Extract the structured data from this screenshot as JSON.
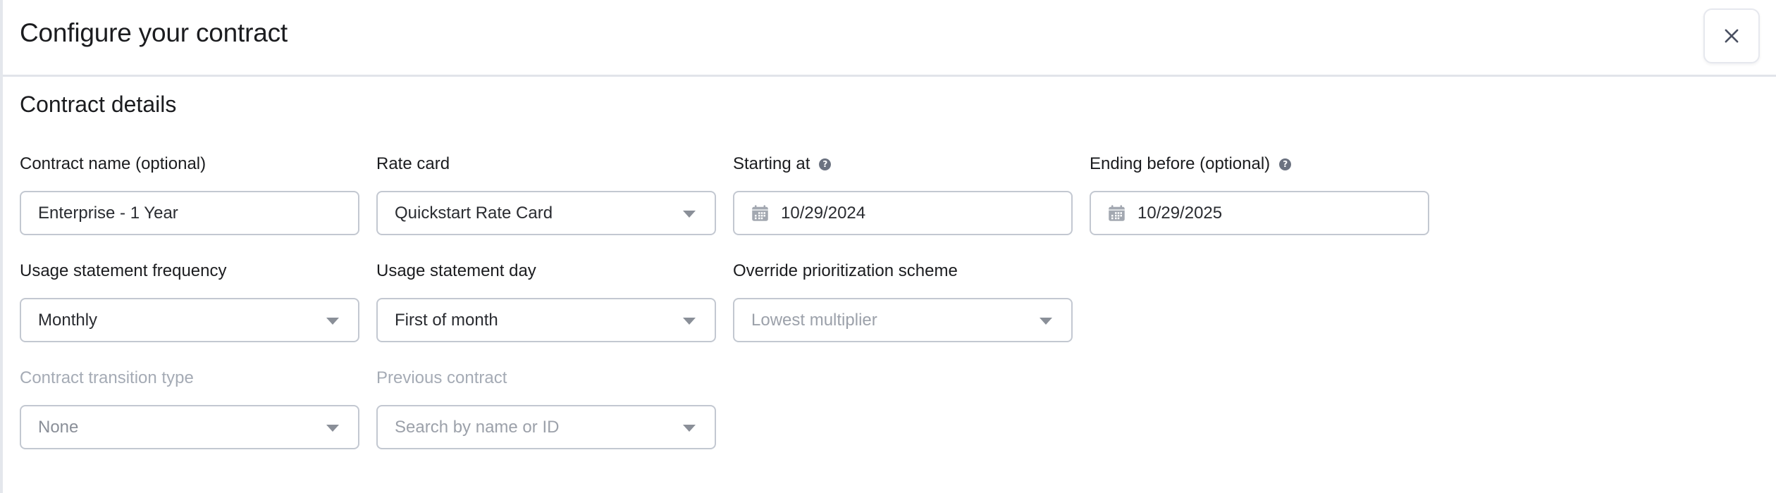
{
  "dialog": {
    "title": "Configure your contract",
    "close_icon": "close-icon"
  },
  "section": {
    "title": "Contract details"
  },
  "fields": {
    "contract_name": {
      "label": "Contract name (optional)",
      "value": "Enterprise - 1 Year"
    },
    "rate_card": {
      "label": "Rate card",
      "value": "Quickstart Rate Card",
      "icon": "chevron-down-icon"
    },
    "starting_at": {
      "label": "Starting at",
      "help_icon": "help-icon",
      "help_glyph": "?",
      "value": "10/29/2024",
      "icon": "calendar-icon"
    },
    "ending_before": {
      "label": "Ending before (optional)",
      "help_icon": "help-icon",
      "help_glyph": "?",
      "value": "10/29/2025",
      "icon": "calendar-icon"
    },
    "usage_statement_frequency": {
      "label": "Usage statement frequency",
      "value": "Monthly",
      "icon": "chevron-down-icon"
    },
    "usage_statement_day": {
      "label": "Usage statement day",
      "value": "First of month",
      "icon": "chevron-down-icon"
    },
    "override_prioritization_scheme": {
      "label": "Override prioritization scheme",
      "placeholder": "Lowest multiplier",
      "icon": "chevron-down-icon"
    },
    "contract_transition_type": {
      "label": "Contract transition type",
      "value": "None",
      "disabled": true,
      "icon": "chevron-down-icon"
    },
    "previous_contract": {
      "label": "Previous contract",
      "placeholder": "Search by name or ID",
      "disabled": true,
      "icon": "chevron-down-icon"
    }
  },
  "colors": {
    "border": "#c3c8d1",
    "text": "#1b1c1f",
    "placeholder": "#9ca1aa",
    "disabled_label": "#a5abb5",
    "help_icon_bg": "#6b7280",
    "caret": "#8a8f98"
  }
}
